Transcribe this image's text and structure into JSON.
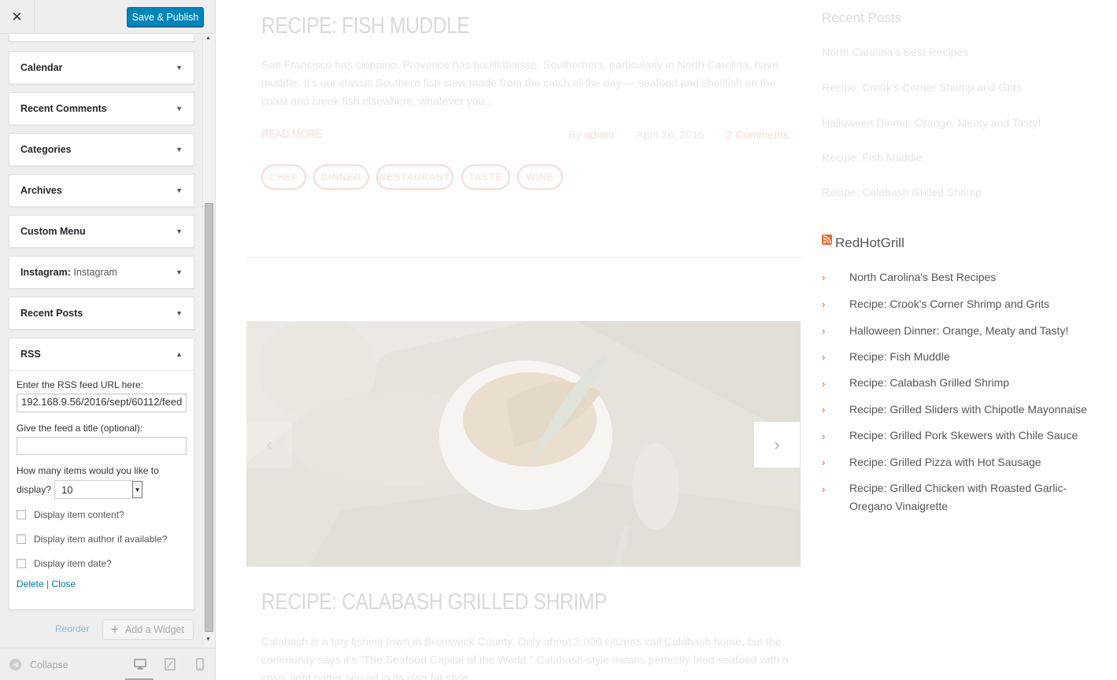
{
  "customizer": {
    "save_label": "Save & Publish",
    "close_glyph": "✕",
    "widgets": [
      {
        "title": "Calendar",
        "subtitle": ""
      },
      {
        "title": "Recent Comments",
        "subtitle": ""
      },
      {
        "title": "Categories",
        "subtitle": ""
      },
      {
        "title": "Archives",
        "subtitle": ""
      },
      {
        "title": "Custom Menu",
        "subtitle": ""
      },
      {
        "title": "Instagram:",
        "subtitle": "Instagram"
      },
      {
        "title": "Recent Posts",
        "subtitle": ""
      }
    ],
    "rss": {
      "title": "RSS",
      "url_label": "Enter the RSS feed URL here:",
      "url_value": "192.168.9.56/2016/sept/60112/feed",
      "feed_title_label": "Give the feed a title (optional):",
      "feed_title_value": "",
      "items_label_1": "How many items would you like to",
      "items_label_2": "display?",
      "items_value": "10",
      "checkboxes": [
        {
          "label": "Display item content?",
          "checked": false
        },
        {
          "label": "Display item author if available?",
          "checked": false
        },
        {
          "label": "Display item date?",
          "checked": false
        }
      ],
      "delete_label": "Delete",
      "link_separator": "|",
      "close_label": "Close"
    },
    "reorder_label": "Reorder",
    "add_widget_label": "Add a Widget",
    "collapse_label": "Collapse"
  },
  "preview": {
    "post1": {
      "title": "RECIPE: FISH MUDDLE",
      "excerpt": [
        "San Francisco has cioppino. Provence has bouillabaisse. Southerners, particularly in North Carolina, have",
        "muddle. It's our classic Southern fish stew made from the catch of the day — seafood and shellfish on the",
        "coast and creek fish elsewhere, whatever you..."
      ],
      "read_more": "READ MORE",
      "by": "By",
      "author": "admin",
      "date": "April 26, 2016",
      "comments": "2 Comments",
      "tags": [
        "CHEF",
        "DINNER",
        "RESTAURANT",
        "TASTE",
        "WINE"
      ]
    },
    "post2": {
      "title": "RECIPE: CALABASH GRILLED SHRIMP",
      "excerpt": [
        "Calabash is a tiny fishing town in Brunswick County. Only about 2,000 citizens call Calabash home, but the",
        "community says it's \"The Seafood Capital of the World.\" Calabash-style means perfectly fried seafood with a",
        "crisp, light batter served in its own fat style."
      ]
    },
    "slider_prev": "‹",
    "slider_next": "›",
    "recent_posts": {
      "title": "Recent Posts",
      "items": [
        "North Carolina's Best Recipes",
        "Recipe: Crook's Corner Shrimp and Grits",
        "Halloween Dinner: Orange, Meaty and Tasty!",
        "Recipe: Fish Muddle",
        "Recipe: Calabash Grilled Shrimp"
      ]
    },
    "rss_widget": {
      "title": "RedHotGrill",
      "bullet": "›",
      "items": [
        "North Carolina's Best Recipes",
        "Recipe: Crook's Corner Shrimp and Grits",
        "Halloween Dinner: Orange, Meaty and Tasty!",
        "Recipe: Fish Muddle",
        "Recipe: Calabash Grilled Shrimp",
        "Recipe: Grilled Sliders with Chipotle Mayonnaise",
        "Recipe: Grilled Pork Skewers with Chile Sauce",
        "Recipe: Grilled Pizza with Hot Sausage",
        "Recipe: Grilled Chicken with Roasted Garlic-",
        "Oregano Vinaigrette"
      ]
    }
  },
  "colors": {
    "accent": "#e25c3e",
    "primary_button": "#0085ba",
    "link": "#0073aa",
    "rss_orange": "#f26522"
  }
}
